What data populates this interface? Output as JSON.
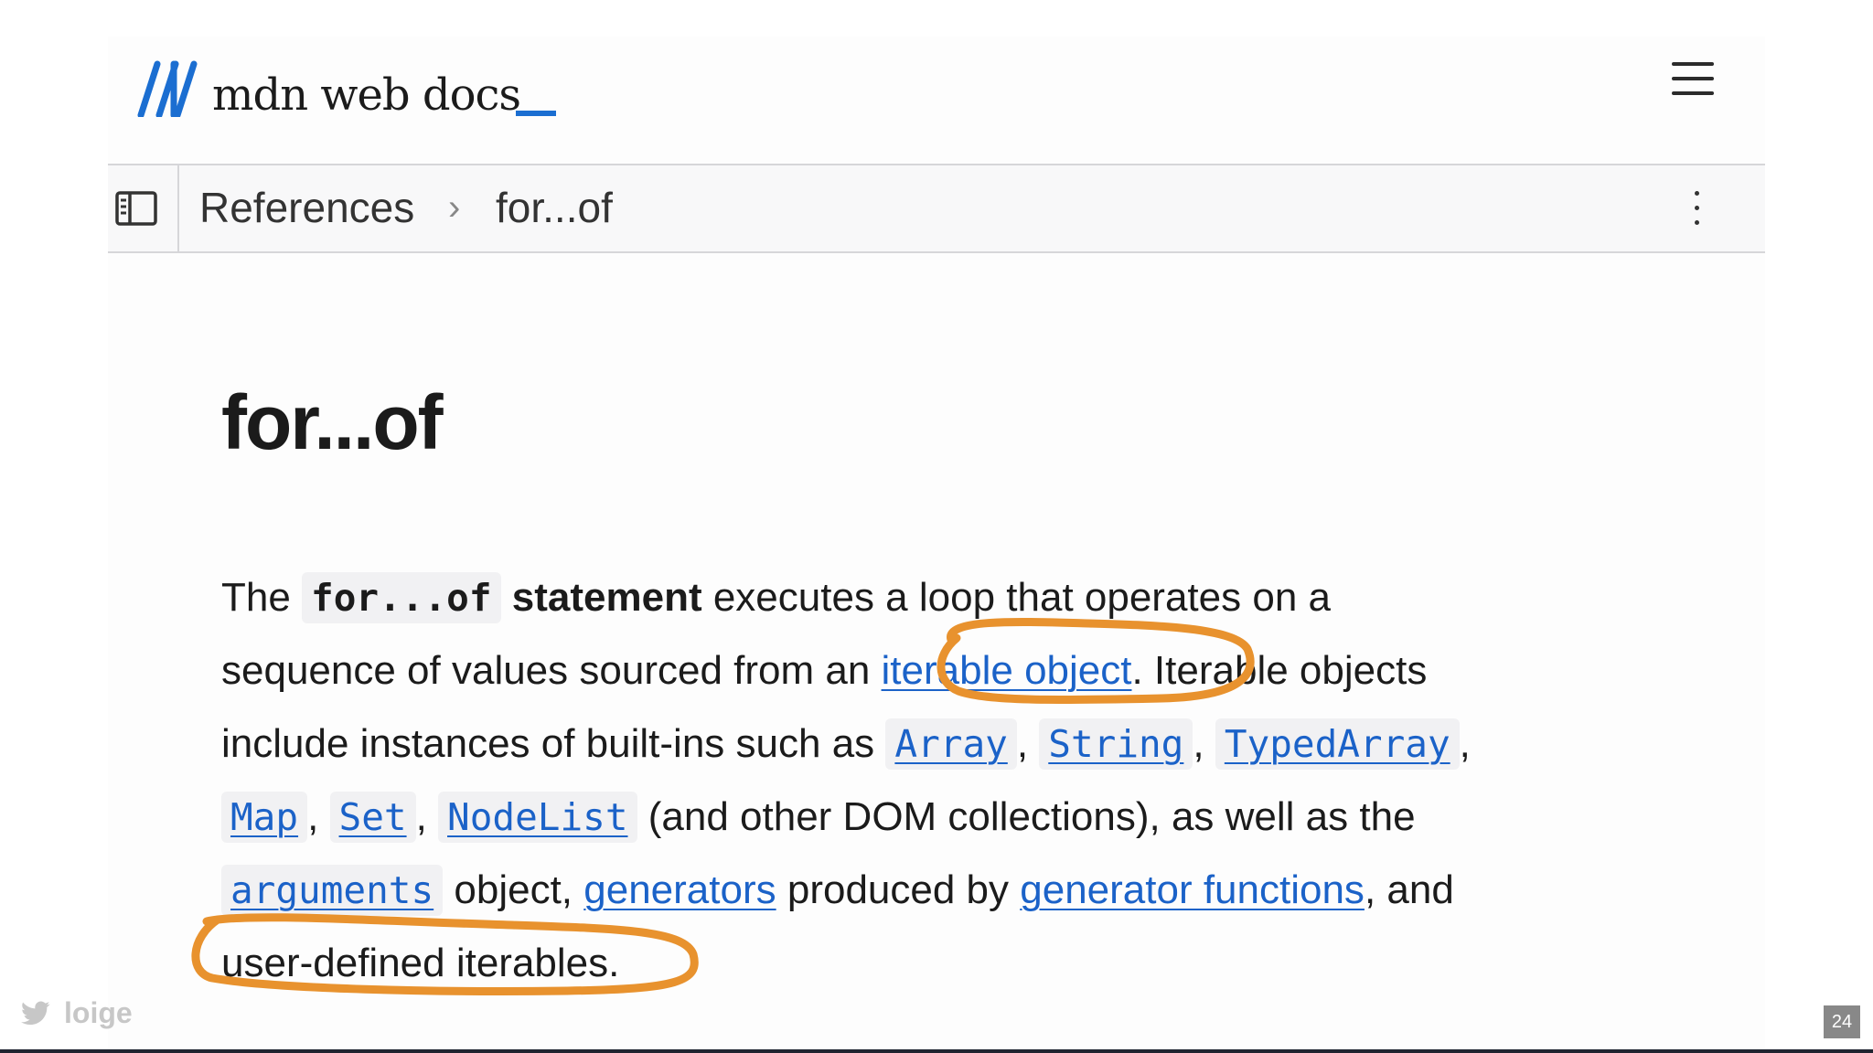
{
  "header": {
    "logo_text": "mdn web docs",
    "menu_icon": "hamburger-icon"
  },
  "breadcrumb": {
    "items": [
      "References",
      "for...of"
    ],
    "separator": "›",
    "sidebar_icon": "sidebar-toggle-icon",
    "more_icon": "more-vertical-icon"
  },
  "article": {
    "title": "for...of",
    "p1": {
      "t1": "The ",
      "code_stmt": "for...of",
      "bold": " statement",
      "t2": " executes a loop that operates on a",
      "t3": "sequence of values sourced from an ",
      "link_iterable": "iterable object",
      "t4": ". Iterable objects",
      "t5": "include instances of built-ins such as ",
      "code_array": "Array",
      "c1": ", ",
      "code_string": "String",
      "c2": ", ",
      "code_typedarray": "TypedArray",
      "c3": ",",
      "code_map": "Map",
      "c4": ", ",
      "code_set": "Set",
      "c5": ", ",
      "code_nodelist": "NodeList",
      "t6": " (and other DOM collections), as well as the",
      "code_arguments": "arguments",
      "t7": " object, ",
      "link_generators": "generators",
      "t8": " produced by ",
      "link_generator_functions": "generator functions",
      "t9": ", and",
      "t10": "user-defined iterables."
    }
  },
  "footer": {
    "twitter_handle": "loige",
    "slide_number": "24"
  },
  "colors": {
    "link": "#1b62c8",
    "brand": "#1b6ed1",
    "annotation": "#e8922e"
  }
}
